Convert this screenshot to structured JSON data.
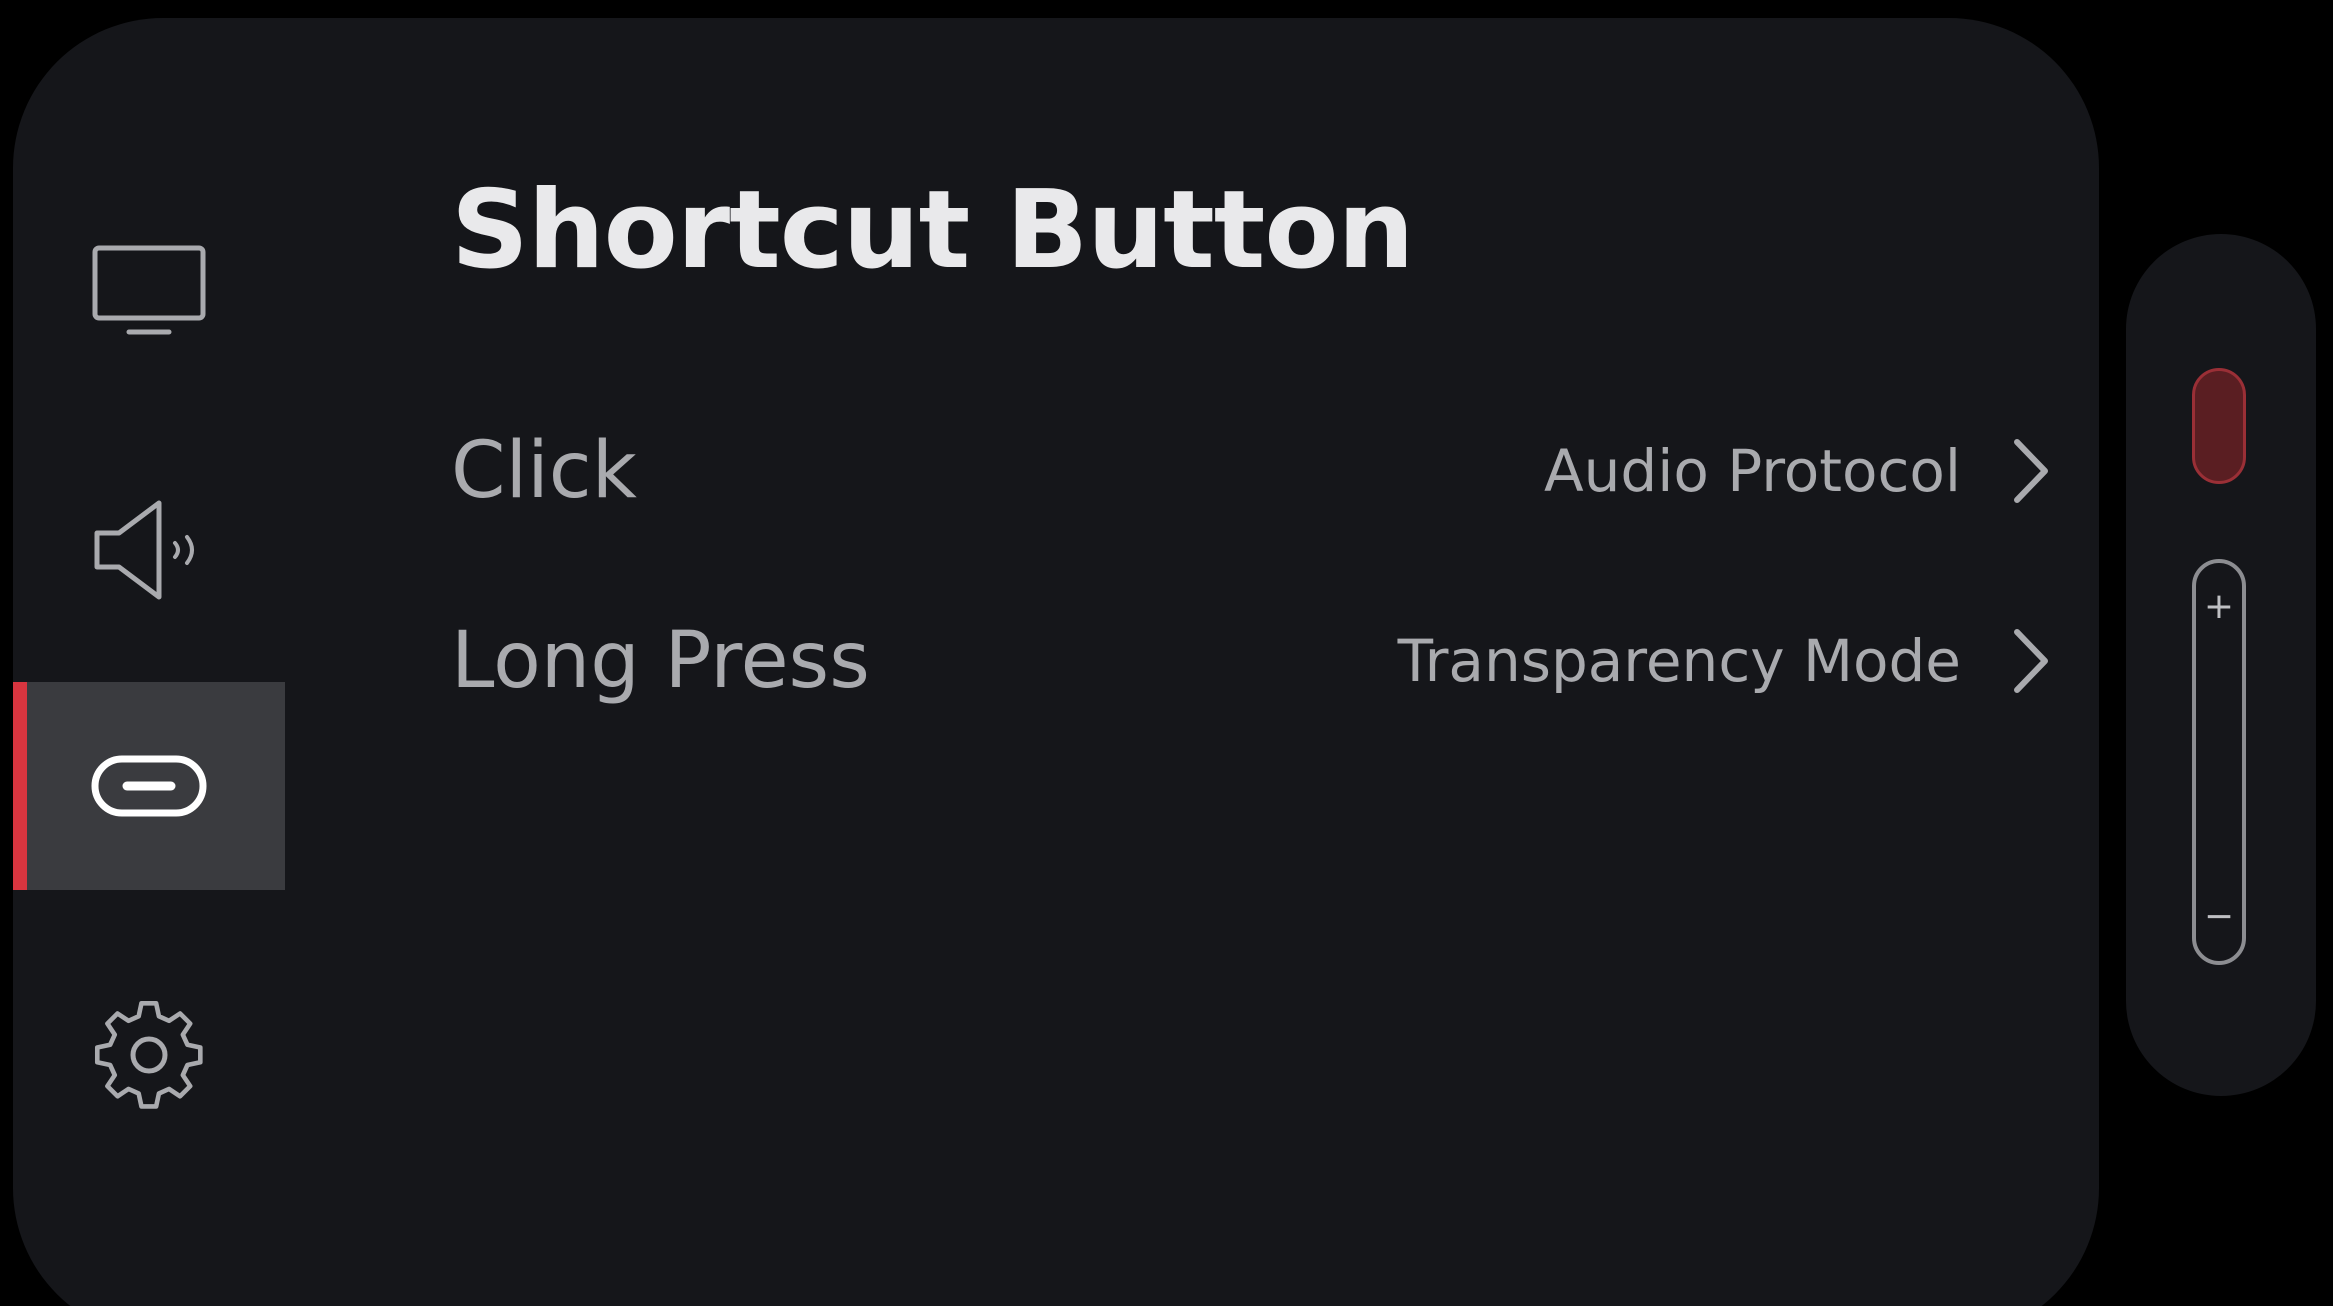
{
  "page": {
    "title": "Shortcut Button"
  },
  "sidebar": {
    "items": [
      {
        "name": "display",
        "icon": "monitor-icon",
        "active": false
      },
      {
        "name": "sound",
        "icon": "speaker-icon",
        "active": false
      },
      {
        "name": "shortcut-button",
        "icon": "capsule-button-icon",
        "active": true
      },
      {
        "name": "settings",
        "icon": "gear-icon",
        "active": false
      }
    ]
  },
  "settings": {
    "rows": [
      {
        "label": "Click",
        "value": "Audio Protocol",
        "icon": "chevron-right-icon"
      },
      {
        "label": "Long Press",
        "value": "Transparency Mode",
        "icon": "chevron-right-icon"
      }
    ]
  },
  "remote": {
    "record_button": "record-button",
    "volume_up": "+",
    "volume_down": "−"
  },
  "colors": {
    "background": "#000000",
    "panel": "#15161a",
    "active_item": "#3a3b3f",
    "accent": "#d8353f",
    "title_text": "#e9e9eb",
    "secondary_text": "#a9aaae"
  }
}
